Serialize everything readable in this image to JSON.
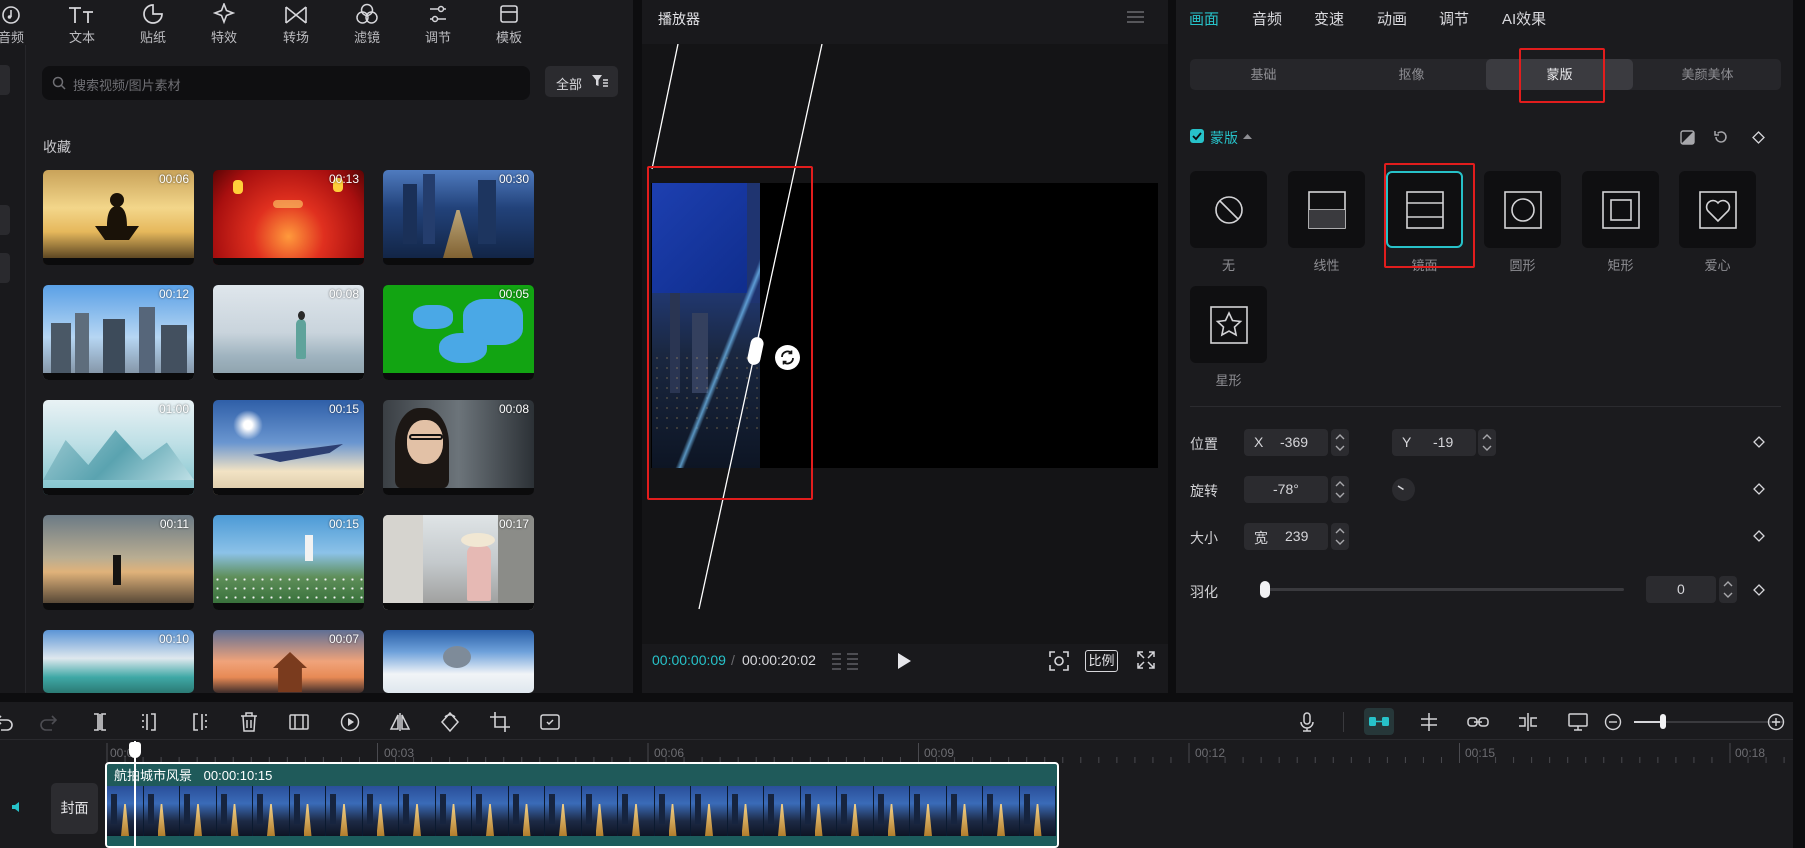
{
  "left_panel": {
    "tools": [
      {
        "label": "音频",
        "icon": "music-note-icon"
      },
      {
        "label": "文本",
        "icon": "text-icon"
      },
      {
        "label": "贴纸",
        "icon": "sticker-icon"
      },
      {
        "label": "特效",
        "icon": "sparkle-icon"
      },
      {
        "label": "转场",
        "icon": "transition-icon"
      },
      {
        "label": "滤镜",
        "icon": "filter-icon"
      },
      {
        "label": "调节",
        "icon": "sliders-icon"
      },
      {
        "label": "模板",
        "icon": "template-icon"
      }
    ],
    "search_placeholder": "搜索视频/图片素材",
    "filter_label": "全部",
    "section_title": "收藏",
    "thumbs": [
      {
        "duration": "00:06",
        "scene": "meditation"
      },
      {
        "duration": "00:13",
        "scene": "red-festival"
      },
      {
        "duration": "00:30",
        "scene": "city-night"
      },
      {
        "duration": "00:12",
        "scene": "city-day"
      },
      {
        "duration": "00:08",
        "scene": "beach-girl"
      },
      {
        "duration": "00:05",
        "scene": "green-screen"
      },
      {
        "duration": "01:00",
        "scene": "ink-landscape"
      },
      {
        "duration": "00:15",
        "scene": "airplane"
      },
      {
        "duration": "00:08",
        "scene": "woman-glasses"
      },
      {
        "duration": "00:11",
        "scene": "sunset-person"
      },
      {
        "duration": "00:15",
        "scene": "flower-hill"
      },
      {
        "duration": "00:17",
        "scene": "alley-girl"
      },
      {
        "duration": "00:10",
        "scene": "lake-mountain"
      },
      {
        "duration": "00:07",
        "scene": "pagoda"
      },
      {
        "duration": "",
        "scene": "snow"
      }
    ]
  },
  "player": {
    "title": "播放器",
    "timecode_current": "00:00:00:09",
    "timecode_sep": "/",
    "timecode_total": "00:00:20:02",
    "ratio_label": "比例"
  },
  "right_panel": {
    "tabs": [
      "画面",
      "音频",
      "变速",
      "动画",
      "调节",
      "AI效果"
    ],
    "active_tab": "画面",
    "subtabs": [
      "基础",
      "抠像",
      "蒙版",
      "美颜美体"
    ],
    "active_subtab": "蒙版",
    "mask_section_label": "蒙版",
    "masks": [
      {
        "label": "无",
        "icon": "none-icon"
      },
      {
        "label": "线性",
        "icon": "linear-mask-icon"
      },
      {
        "label": "镜面",
        "icon": "mirror-mask-icon"
      },
      {
        "label": "圆形",
        "icon": "circle-mask-icon"
      },
      {
        "label": "矩形",
        "icon": "rect-mask-icon"
      },
      {
        "label": "爱心",
        "icon": "heart-mask-icon"
      },
      {
        "label": "星形",
        "icon": "star-mask-icon"
      }
    ],
    "active_mask": "镜面",
    "position_label": "位置",
    "x_label": "X",
    "x_value": "-369",
    "y_label": "Y",
    "y_value": "-19",
    "rotate_label": "旋转",
    "rotate_value": "-78°",
    "size_label": "大小",
    "width_label": "宽",
    "width_value": "239",
    "feather_label": "羽化",
    "feather_value": "0",
    "feather_level": 0
  },
  "timeline": {
    "ruler_labels": [
      "00:00",
      "00:03",
      "00:06",
      "00:09",
      "00:12",
      "00:15",
      "00:18"
    ],
    "cover_label": "封面",
    "clip_name": "航拍城市风景",
    "clip_duration": "00:00:10:15"
  },
  "colors": {
    "accent": "#27c2c9",
    "highlight": "#e21d1d"
  }
}
